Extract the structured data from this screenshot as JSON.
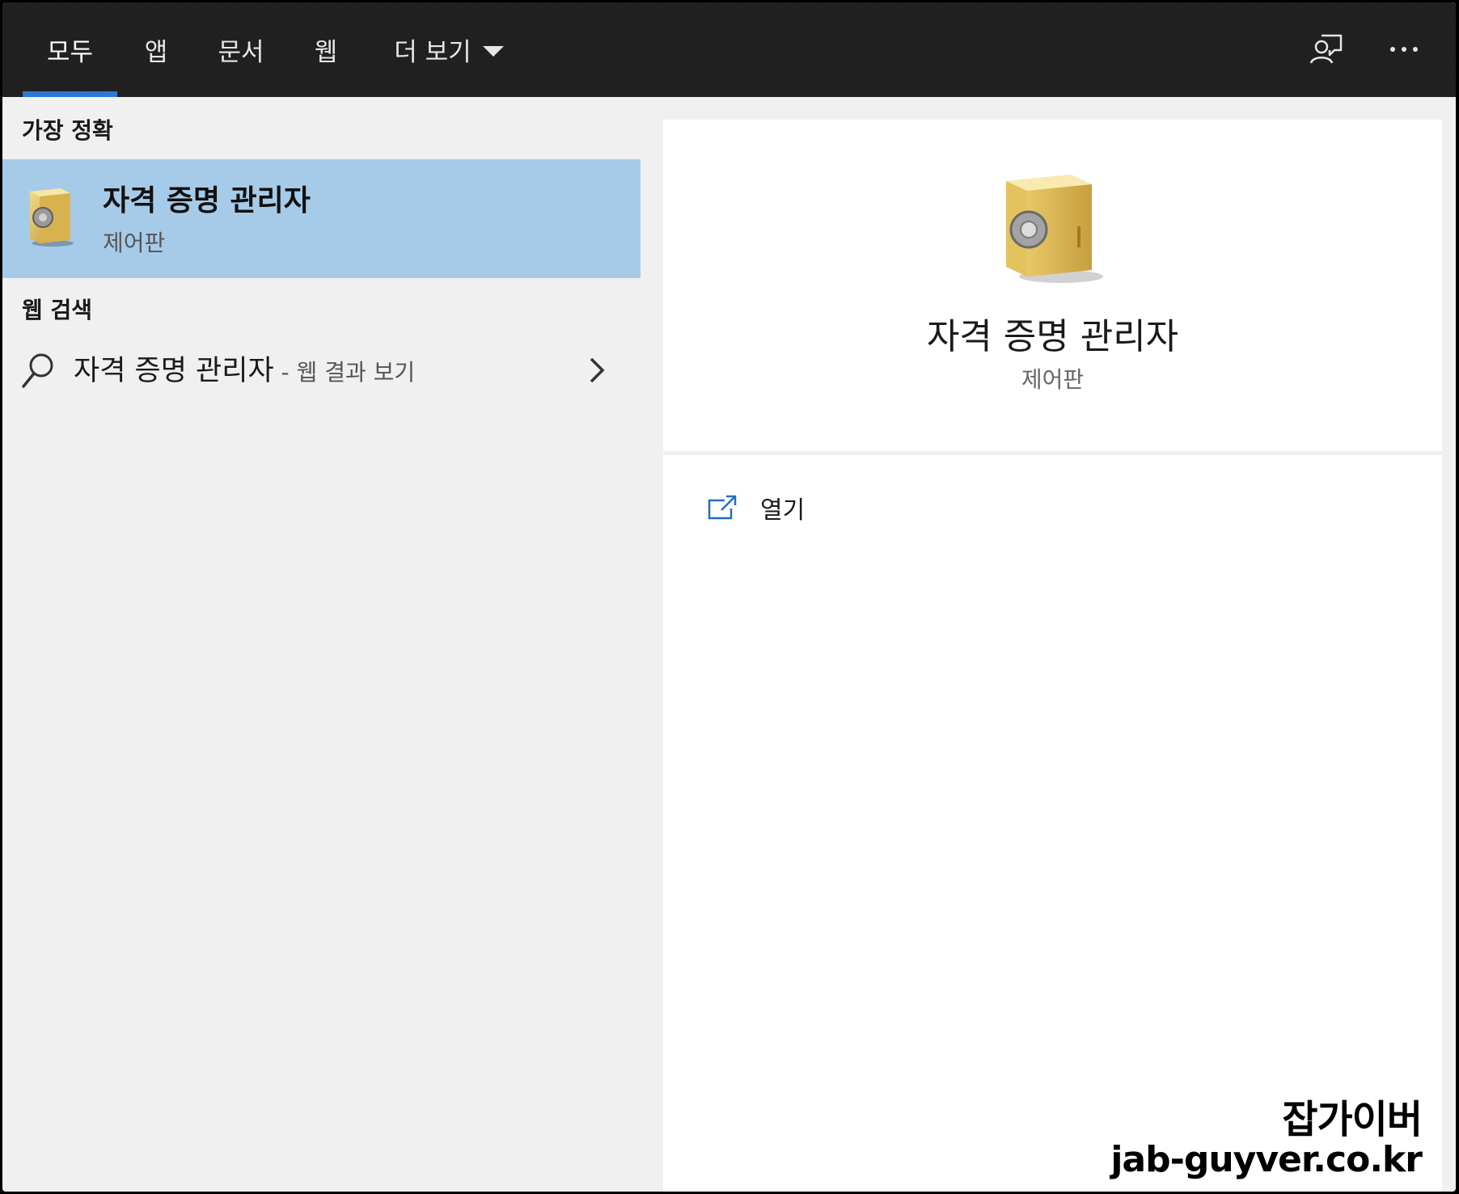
{
  "tabs": {
    "all": "모두",
    "apps": "앱",
    "documents": "문서",
    "web": "웹",
    "more": "더 보기"
  },
  "best_match": {
    "heading": "가장 정확",
    "title": "자격 증명 관리자",
    "subtitle": "제어판"
  },
  "web_search": {
    "heading": "웹 검색",
    "query": "자격 증명 관리자",
    "suffix": " - 웹 결과 보기"
  },
  "detail": {
    "title": "자격 증명 관리자",
    "subtitle": "제어판",
    "action_open": "열기"
  },
  "watermark": {
    "line1": "잡가이버",
    "line2": "jab-guyver.co.kr"
  },
  "colors": {
    "topbar": "#1f1f1f",
    "accent": "#2b79d3",
    "selected": "#a6cbe9",
    "panel": "#f0f0f0"
  },
  "icons": {
    "feedback": "feedback-person-icon",
    "more": "ellipsis-icon",
    "search": "search-icon",
    "chevron": "chevron-right-icon",
    "open": "open-external-icon",
    "app": "credential-safe-icon"
  }
}
